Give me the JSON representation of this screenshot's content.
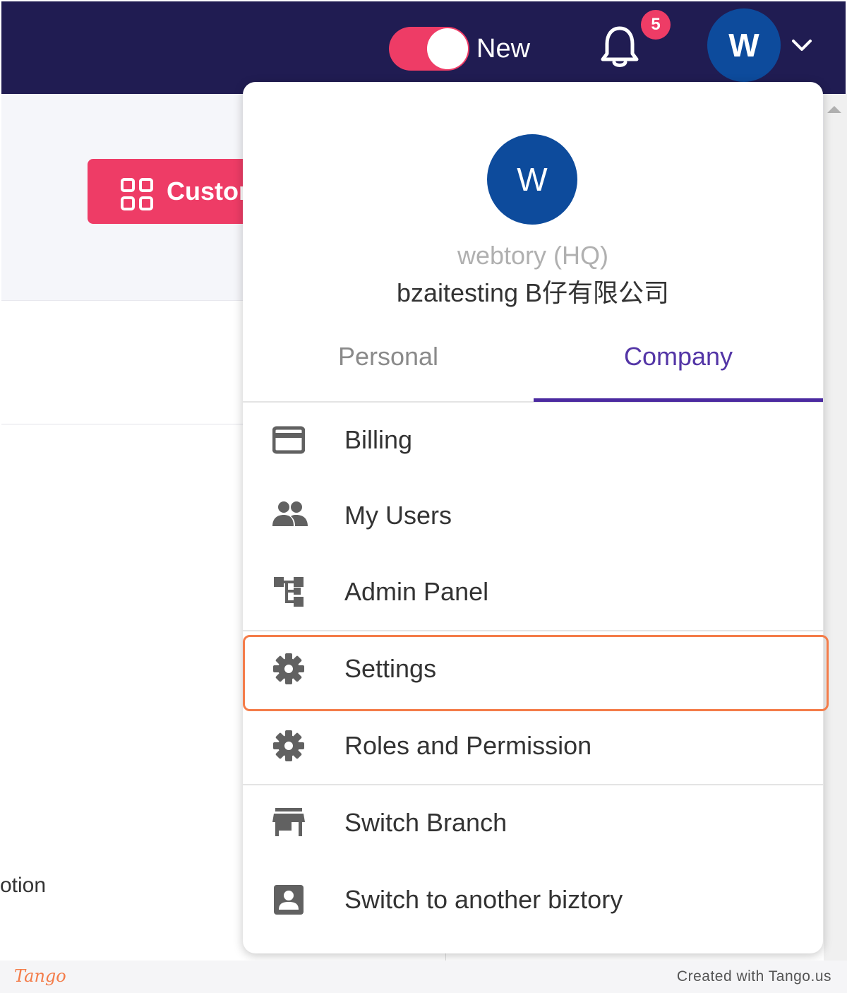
{
  "header": {
    "toggle_label": "New",
    "notification_count": "5",
    "avatar_initial": "W"
  },
  "background": {
    "customize_button_label": "Custor",
    "partial_text": "otion"
  },
  "menu": {
    "avatar_initial": "W",
    "org_hq": "webtory (HQ)",
    "org_name": "bzaitesting B仔有限公司",
    "tabs": [
      {
        "label": "Personal",
        "active": false
      },
      {
        "label": "Company",
        "active": true
      }
    ],
    "items": [
      {
        "label": "Billing",
        "icon": "credit-card-icon"
      },
      {
        "label": "My Users",
        "icon": "people-icon"
      },
      {
        "label": "Admin Panel",
        "icon": "hierarchy-icon"
      },
      {
        "label": "Settings",
        "icon": "gear-icon",
        "highlighted": true
      },
      {
        "label": "Roles and Permission",
        "icon": "gear-icon"
      },
      {
        "label": "Switch Branch",
        "icon": "store-icon"
      },
      {
        "label": "Switch to another biztory",
        "icon": "contact-box-icon"
      }
    ]
  },
  "footer": {
    "brand": "Tango",
    "credit": "Created with Tango.us"
  },
  "colors": {
    "topbar": "#201c52",
    "accent_pink": "#ee3c66",
    "avatar_blue": "#0d4b9c",
    "tab_active": "#5335a6",
    "highlight_orange": "#f47c49"
  }
}
